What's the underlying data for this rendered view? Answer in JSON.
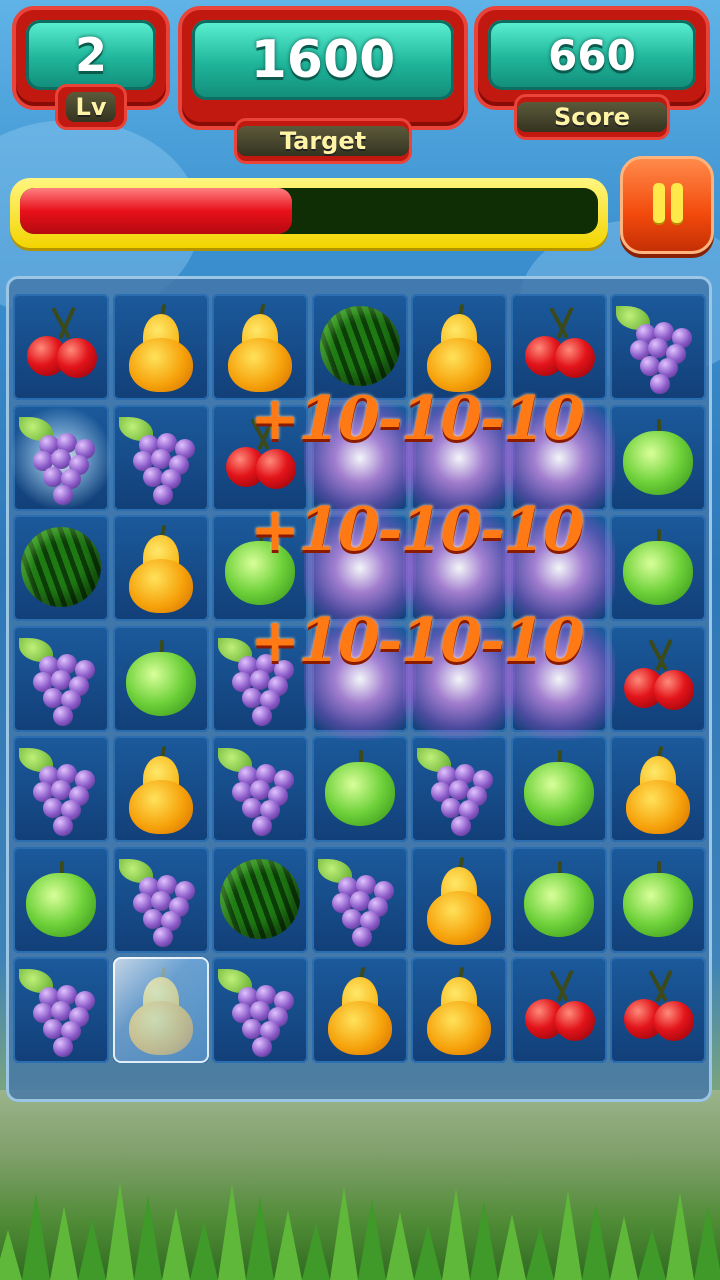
{
  "hud": {
    "level": {
      "value": "2",
      "label": "Lv"
    },
    "target": {
      "value": "1600",
      "label": "Target"
    },
    "score": {
      "value": "660",
      "label": "Score"
    }
  },
  "progress": {
    "fraction": 0.47
  },
  "controls": {
    "pause_icon": "pause-icon"
  },
  "board": {
    "rows": 7,
    "cols": 7,
    "grid": [
      [
        "cherry",
        "pear",
        "pear",
        "watermelon",
        "pear",
        "cherry",
        "grape"
      ],
      [
        "grape",
        "grape",
        "cherry",
        "",
        "",
        "",
        "apple"
      ],
      [
        "watermelon",
        "pear",
        "apple",
        "",
        "",
        "",
        "apple"
      ],
      [
        "grape",
        "apple",
        "grape",
        "",
        "",
        "",
        "cherry"
      ],
      [
        "grape",
        "pear",
        "grape",
        "apple",
        "grape",
        "apple",
        "pear"
      ],
      [
        "apple",
        "grape",
        "watermelon",
        "grape",
        "pear",
        "apple",
        "apple"
      ],
      [
        "grape",
        "pear",
        "grape",
        "pear",
        "pear",
        "cherry",
        "cherry"
      ]
    ],
    "frozen_cells": [
      [
        6,
        1
      ]
    ],
    "sparkle_cells": [
      [
        1,
        0
      ]
    ],
    "score_popups": [
      "+10-10-10",
      "+10-10-10",
      "+10-10-10"
    ]
  }
}
